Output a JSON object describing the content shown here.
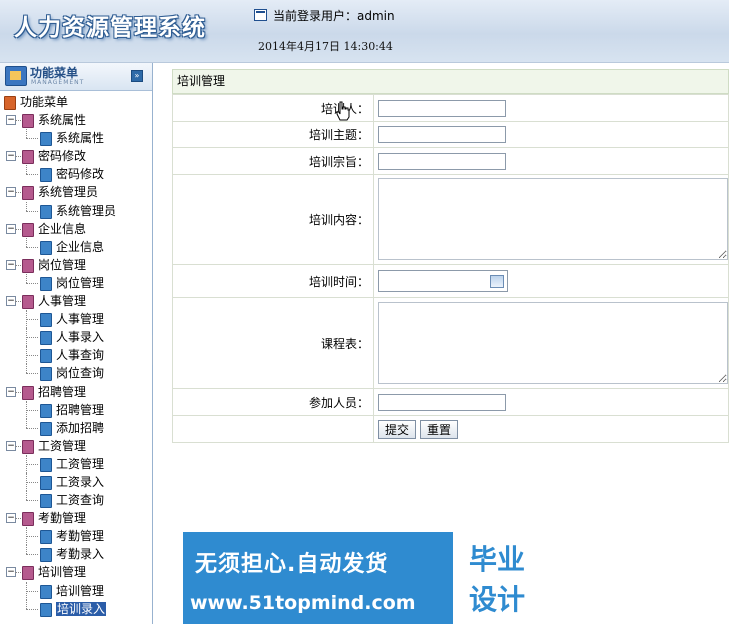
{
  "header": {
    "system_title": "人力资源管理系统",
    "user_label": "当前登录用户：admin",
    "datetime": "2014年4月17日  14:30:44"
  },
  "sidebar": {
    "title": "功能菜单",
    "subtitle": "MANAGEMENT",
    "collapse_glyph": "»",
    "root_label": "功能菜单",
    "groups": [
      {
        "label": "系统属性",
        "items": [
          "系统属性"
        ]
      },
      {
        "label": "密码修改",
        "items": [
          "密码修改"
        ]
      },
      {
        "label": "系统管理员",
        "items": [
          "系统管理员"
        ]
      },
      {
        "label": "企业信息",
        "items": [
          "企业信息"
        ]
      },
      {
        "label": "岗位管理",
        "items": [
          "岗位管理"
        ]
      },
      {
        "label": "人事管理",
        "items": [
          "人事管理",
          "人事录入",
          "人事查询",
          "岗位查询"
        ]
      },
      {
        "label": "招聘管理",
        "items": [
          "招聘管理",
          "添加招聘"
        ]
      },
      {
        "label": "工资管理",
        "items": [
          "工资管理",
          "工资录入",
          "工资查询"
        ]
      },
      {
        "label": "考勤管理",
        "items": [
          "考勤管理",
          "考勤录入"
        ]
      },
      {
        "label": "培训管理",
        "items": [
          "培训管理",
          "培训录入"
        ]
      }
    ],
    "selected_item": "培训录入"
  },
  "main": {
    "panel_title": "培训管理",
    "fields": {
      "trainer": {
        "label": "培训人：",
        "value": ""
      },
      "subject": {
        "label": "培训主题：",
        "value": ""
      },
      "purpose": {
        "label": "培训宗旨：",
        "value": ""
      },
      "content": {
        "label": "培训内容：",
        "value": ""
      },
      "time": {
        "label": "培训时间：",
        "value": ""
      },
      "schedule": {
        "label": "课程表：",
        "value": ""
      },
      "participants": {
        "label": "参加人员：",
        "value": ""
      }
    },
    "submit_label": "提交",
    "reset_label": "重置"
  },
  "watermark": {
    "line1": "无须担心.自动发货",
    "line2": "www.51topmind.com",
    "badge_top": "毕业",
    "badge_bottom": "设计"
  }
}
